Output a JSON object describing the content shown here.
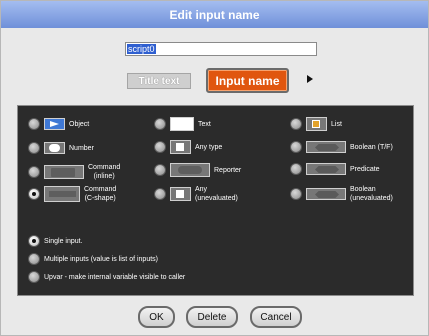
{
  "dialog": {
    "title": "Edit input name",
    "name_value": "script0",
    "tabs": {
      "title_text": "Title text",
      "input_name": "Input name"
    }
  },
  "types": [
    {
      "key": "object",
      "label": "Object"
    },
    {
      "key": "text",
      "label": "Text"
    },
    {
      "key": "list",
      "label": "List"
    },
    {
      "key": "number",
      "label": "Number"
    },
    {
      "key": "any_type",
      "label": "Any type"
    },
    {
      "key": "boolean",
      "label": "Boolean (T/F)"
    },
    {
      "key": "command_inline",
      "label": "Command\n(inline)"
    },
    {
      "key": "reporter",
      "label": "Reporter"
    },
    {
      "key": "predicate",
      "label": "Predicate"
    },
    {
      "key": "command_c",
      "label": "Command\n(C-shape)",
      "selected": true
    },
    {
      "key": "any_unevaluated",
      "label": "Any\n(unevaluated)"
    },
    {
      "key": "boolean_unevaluated",
      "label": "Boolean\n(unevaluated)"
    }
  ],
  "modes": [
    {
      "label": "Single input.",
      "selected": true
    },
    {
      "label": "Multiple inputs (value is list of inputs)"
    },
    {
      "label": "Upvar - make internal variable visible to caller"
    }
  ],
  "buttons": {
    "ok": "OK",
    "delete": "Delete",
    "cancel": "Cancel"
  },
  "colors": {
    "accent_tab": "#e0560f",
    "object_slot": "#3f78d4",
    "list_slot": "#e2a22a"
  }
}
